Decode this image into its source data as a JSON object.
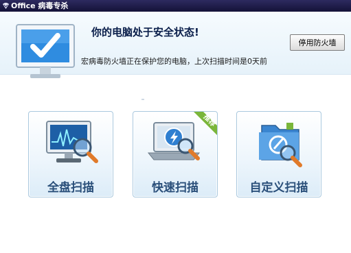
{
  "window": {
    "title": "Office 病毒专杀"
  },
  "status": {
    "title": "你的电脑处于安全状态!",
    "description": "宏病毒防火墙正在保护您的电脑，上次扫描时间是0天前",
    "disable_button": "停用防火墙",
    "icon": "monitor-checkmark-icon"
  },
  "scan_options": [
    {
      "label": "全盘扫描",
      "icon": "monitor-magnifier-icon"
    },
    {
      "label": "快速扫描",
      "icon": "laptop-lightning-icon",
      "badge": "推荐"
    },
    {
      "label": "自定义扫描",
      "icon": "folder-target-icon"
    }
  ],
  "colors": {
    "titlebar": "#1b1a45",
    "badge": "#7ab63a",
    "accent": "#2a7cc8"
  }
}
